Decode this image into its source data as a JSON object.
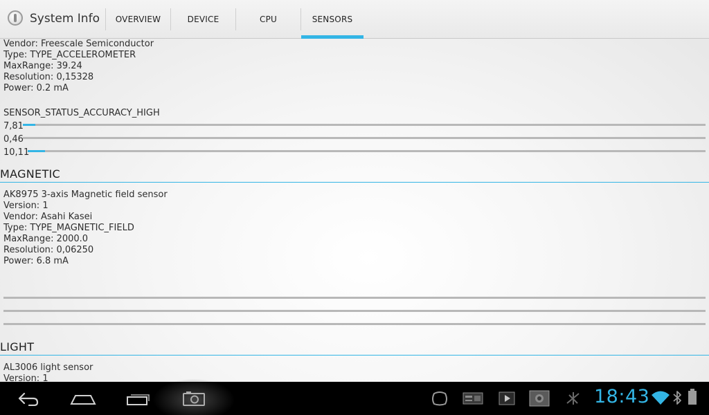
{
  "app": {
    "title": "System Info"
  },
  "tabs": [
    {
      "label": "OVERVIEW",
      "active": false
    },
    {
      "label": "DEVICE",
      "active": false
    },
    {
      "label": "CPU",
      "active": false
    },
    {
      "label": "SENSORS",
      "active": true
    }
  ],
  "accelerometer": {
    "lines": [
      "Vendor: Freescale Semiconductor",
      "Type: TYPE_ACCELEROMETER",
      "MaxRange: 39.24",
      "Resolution: 0,15328",
      "Power: 0.2 mA"
    ],
    "status": "SENSOR_STATUS_ACCURACY_HIGH",
    "readings": [
      {
        "label": "7,81",
        "fraction": 0.018
      },
      {
        "label": "0,46",
        "fraction": 0.0
      },
      {
        "label": "10,11",
        "fraction": 0.026
      }
    ]
  },
  "magnetic": {
    "heading": "MAGNETIC",
    "lines": [
      "AK8975 3-axis Magnetic field sensor",
      "Version: 1",
      "Vendor: Asahi Kasei",
      "Type: TYPE_MAGNETIC_FIELD",
      "MaxRange: 2000.0",
      "Resolution: 0,06250",
      "Power: 6.8 mA"
    ],
    "readings": [
      {
        "fraction": 0.0
      },
      {
        "fraction": 0.0
      },
      {
        "fraction": 0.0
      }
    ]
  },
  "light": {
    "heading": "LIGHT",
    "lines": [
      "AL3006 light sensor",
      "Version: 1"
    ]
  },
  "status_bar": {
    "time": "18:43"
  },
  "colors": {
    "accent": "#33b5e5",
    "navbar": "#000000"
  },
  "icons": {
    "nav": [
      "back-icon",
      "home-icon",
      "recent-apps-icon",
      "screenshot-icon"
    ],
    "notifications": [
      "notification-app-icon",
      "notification-card-icon",
      "notification-media-icon",
      "notification-photo-icon",
      "notification-usb-icon"
    ],
    "status": [
      "wifi-icon",
      "bluetooth-icon",
      "battery-icon"
    ]
  }
}
